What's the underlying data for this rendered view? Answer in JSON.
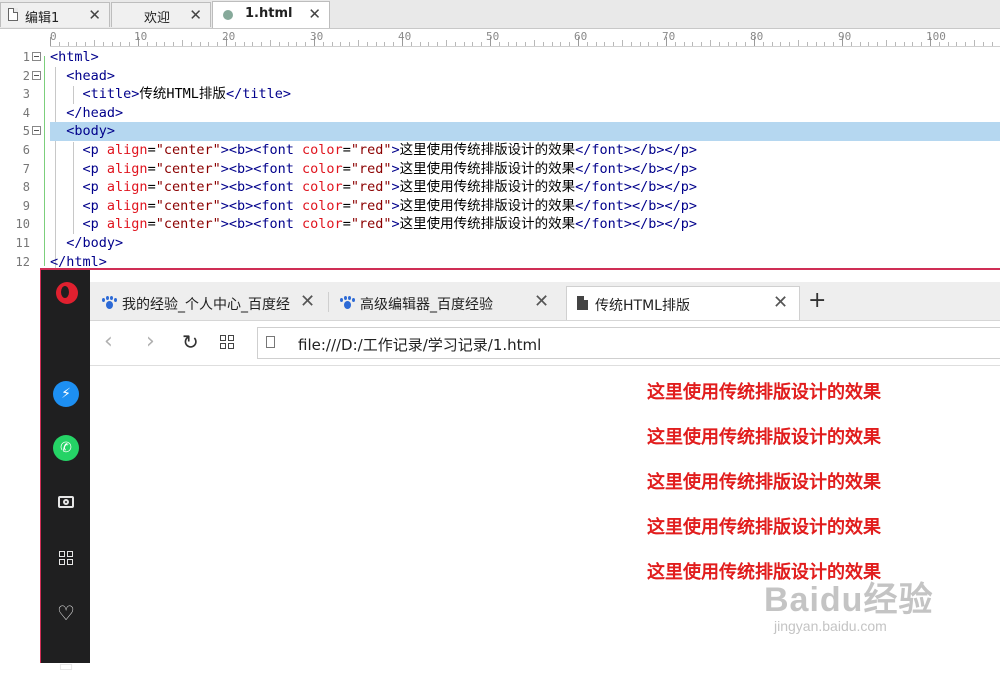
{
  "editor": {
    "tabs": [
      {
        "label": "编辑1"
      },
      {
        "label": "欢迎"
      },
      {
        "label": "1.html"
      }
    ],
    "ruler_labels": [
      "0",
      "10",
      "20",
      "30",
      "40",
      "50",
      "60",
      "70",
      "80",
      "90",
      "100"
    ],
    "line_numbers": [
      "1",
      "2",
      "3",
      "4",
      "5",
      "6",
      "7",
      "8",
      "9",
      "10",
      "11",
      "12"
    ],
    "code": {
      "html_open": "<html>",
      "head_open": "<head>",
      "title_open": "<title>",
      "title_text": "传统HTML排版",
      "title_close": "</title>",
      "head_close": "</head>",
      "body_open": "<body>",
      "p_open": "<p",
      "align_attr": "align",
      "eq": "=",
      "align_val": "\"center\"",
      "gt": ">",
      "b_open": "<b>",
      "font_open": "<font",
      "color_attr": "color",
      "color_val": "\"red\"",
      "line_text": "这里使用传统排版设计的效果",
      "font_close": "</font>",
      "b_close": "</b>",
      "p_close": "</p>",
      "body_close": "</body>",
      "html_close": "</html>"
    }
  },
  "browser": {
    "tabs": [
      {
        "label": "我的经验_个人中心_百度经"
      },
      {
        "label": "高级编辑器_百度经验"
      },
      {
        "label": "传统HTML排版"
      }
    ],
    "new_tab": "+",
    "close_glyph": "✕",
    "address": "file:///D:/工作记录/学习记录/1.html",
    "content_lines": [
      "这里使用传统排版设计的效果",
      "这里使用传统排版设计的效果",
      "这里使用传统排版设计的效果",
      "这里使用传统排版设计的效果",
      "这里使用传统排版设计的效果"
    ],
    "accent_color": "#cf2e55",
    "text_color": "#e11d1d"
  },
  "watermark": {
    "main": "Baidu经验",
    "sub": "jingyan.baidu.com"
  }
}
